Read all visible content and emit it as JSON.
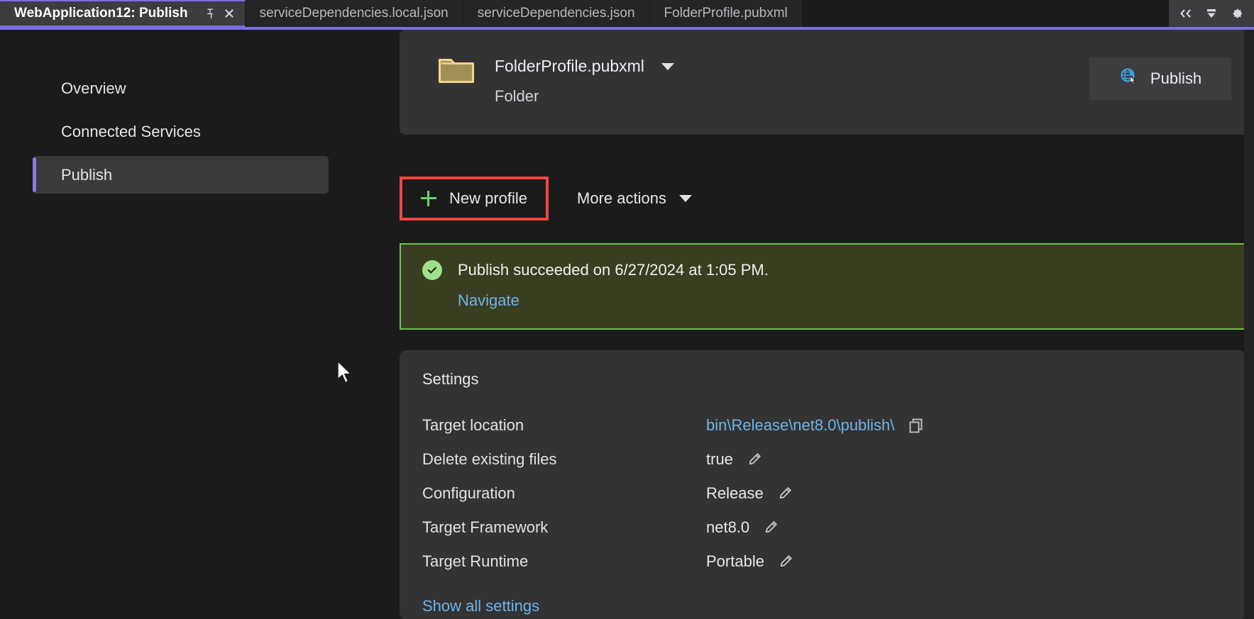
{
  "tabs": [
    {
      "label": "WebApplication12: Publish",
      "active": true,
      "pin_icon": "pin-icon",
      "close_icon": "close-icon"
    },
    {
      "label": "serviceDependencies.local.json",
      "active": false
    },
    {
      "label": "serviceDependencies.json",
      "active": false
    },
    {
      "label": "FolderProfile.pubxml",
      "active": false
    }
  ],
  "tab_tools": [
    {
      "name": "collapse-chevrons-icon",
      "glyph": "«"
    },
    {
      "name": "tab-dropdown-icon",
      "glyph": "▼"
    },
    {
      "name": "settings-gear-icon",
      "glyph": "⚙"
    }
  ],
  "sidebar": {
    "items": [
      {
        "label": "Overview",
        "selected": false
      },
      {
        "label": "Connected Services",
        "selected": false
      },
      {
        "label": "Publish",
        "selected": true
      }
    ]
  },
  "profile_header": {
    "icon": "folder-icon",
    "name": "FolderProfile.pubxml",
    "subtitle": "Folder",
    "dropdown_icon": "chevron-down-icon",
    "publish_button": {
      "label": "Publish",
      "icon": "publish-globe-icon"
    }
  },
  "actions": {
    "new_profile": {
      "label": "New profile",
      "icon": "plus-icon",
      "highlighted": true
    },
    "more_actions": {
      "label": "More actions",
      "icon": "chevron-down-icon"
    }
  },
  "banner": {
    "status_icon": "success-check-icon",
    "message": "Publish succeeded on 6/27/2024 at 1:05 PM.",
    "link": "Navigate"
  },
  "settings": {
    "title": "Settings",
    "rows": [
      {
        "label": "Target location",
        "value": "bin\\Release\\net8.0\\publish\\",
        "is_link": true,
        "action_icon": "copy-icon"
      },
      {
        "label": "Delete existing files",
        "value": "true",
        "is_link": false,
        "action_icon": "pencil-icon"
      },
      {
        "label": "Configuration",
        "value": "Release",
        "is_link": false,
        "action_icon": "pencil-icon"
      },
      {
        "label": "Target Framework",
        "value": "net8.0",
        "is_link": false,
        "action_icon": "pencil-icon"
      },
      {
        "label": "Target Runtime",
        "value": "Portable",
        "is_link": false,
        "action_icon": "pencil-icon"
      }
    ],
    "show_all_link": "Show all settings"
  },
  "colors": {
    "accent_purple": "#7a6ee0",
    "highlight_red": "#f4453c",
    "success_green": "#6fc14b",
    "link_blue": "#6eb3e8",
    "plus_green": "#6cd36c",
    "folder_yellow": "#f3d491"
  }
}
